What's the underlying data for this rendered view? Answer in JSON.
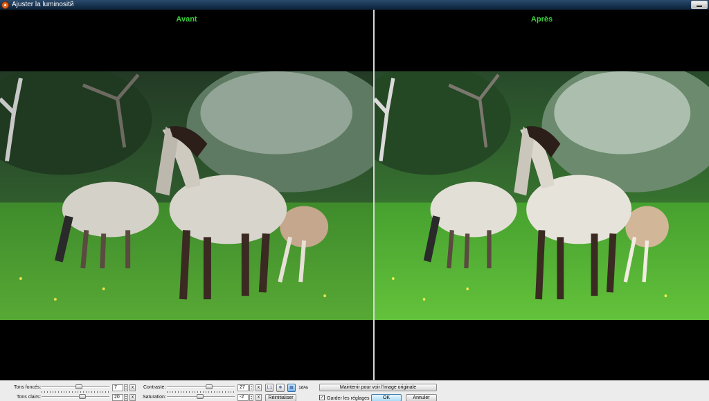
{
  "window": {
    "title": "Ajuster la luminositй"
  },
  "panes": {
    "before_label": "Avant",
    "after_label": "Après"
  },
  "controls": {
    "shadows": {
      "label": "Tons foncés:",
      "value": "7",
      "level": 0.55
    },
    "highlights": {
      "label": "Tons clairs:",
      "value": "20",
      "level": 0.6
    },
    "contrast": {
      "label": "Contraste:",
      "value": "27",
      "level": 0.62
    },
    "saturation": {
      "label": "Saturation:",
      "value": "-2",
      "level": 0.49
    },
    "clear_label": "x",
    "zoom_actual_label": "1:1",
    "zoom_percent": "16%",
    "hold_original_label": "Maintenir pour voir l'image originale",
    "reset_label": "Réinitialiser",
    "keep_settings_label": "Garder les réglages",
    "keep_settings_checked": true,
    "ok_label": "OK",
    "cancel_label": "Annuler"
  }
}
